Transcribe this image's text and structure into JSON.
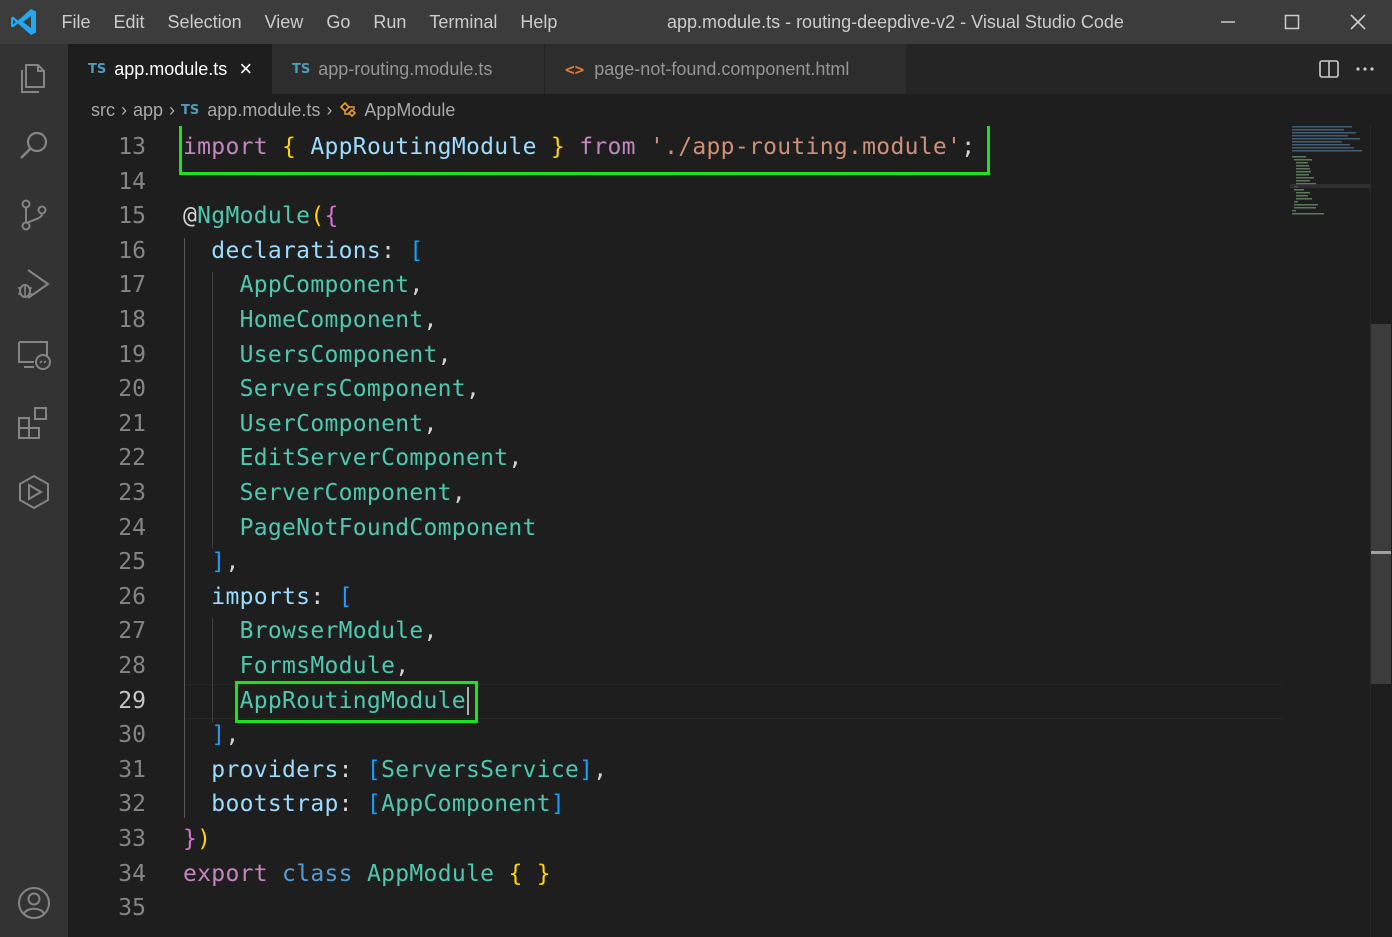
{
  "titlebar": {
    "menu": [
      "File",
      "Edit",
      "Selection",
      "View",
      "Go",
      "Run",
      "Terminal",
      "Help"
    ],
    "title": "app.module.ts - routing-deepdive-v2 - Visual Studio Code"
  },
  "activity_bar": {
    "icons": [
      "explorer-icon",
      "search-icon",
      "source-control-icon",
      "run-debug-icon",
      "remote-explorer-icon",
      "extensions-icon",
      "extra-panel-icon",
      "account-icon"
    ]
  },
  "tabs": [
    {
      "badge": "TS",
      "label": "app.module.ts",
      "active": true
    },
    {
      "badge": "TS",
      "label": "app-routing.module.ts",
      "active": false
    },
    {
      "badge": "<>",
      "label": "page-not-found.component.html",
      "active": false
    }
  ],
  "breadcrumb": {
    "parts": [
      "src",
      "app",
      "app.module.ts",
      "AppModule"
    ],
    "file_badge": "TS"
  },
  "editor": {
    "current_line": "29",
    "lines": [
      {
        "n": "13",
        "tokens": [
          [
            "kw-ctrl",
            "import"
          ],
          [
            "punc",
            " "
          ],
          [
            "brace1",
            "{"
          ],
          [
            "punc",
            " "
          ],
          [
            "prop",
            "AppRoutingModule"
          ],
          [
            "punc",
            " "
          ],
          [
            "brace1",
            "}"
          ],
          [
            "punc",
            " "
          ],
          [
            "kw-ctrl",
            "from"
          ],
          [
            "punc",
            " "
          ],
          [
            "str",
            "'./app-routing.module'"
          ],
          [
            "punc",
            ";"
          ]
        ]
      },
      {
        "n": "14",
        "tokens": []
      },
      {
        "n": "15",
        "tokens": [
          [
            "punc",
            "@"
          ],
          [
            "cls",
            "NgModule"
          ],
          [
            "brace1",
            "("
          ],
          [
            "brace2",
            "{"
          ]
        ]
      },
      {
        "n": "16",
        "tokens": [
          [
            "punc",
            "  "
          ],
          [
            "prop",
            "declarations"
          ],
          [
            "punc",
            ": "
          ],
          [
            "brace3",
            "["
          ]
        ]
      },
      {
        "n": "17",
        "tokens": [
          [
            "punc",
            "    "
          ],
          [
            "cls",
            "AppComponent"
          ],
          [
            "punc",
            ","
          ]
        ]
      },
      {
        "n": "18",
        "tokens": [
          [
            "punc",
            "    "
          ],
          [
            "cls",
            "HomeComponent"
          ],
          [
            "punc",
            ","
          ]
        ]
      },
      {
        "n": "19",
        "tokens": [
          [
            "punc",
            "    "
          ],
          [
            "cls",
            "UsersComponent"
          ],
          [
            "punc",
            ","
          ]
        ]
      },
      {
        "n": "20",
        "tokens": [
          [
            "punc",
            "    "
          ],
          [
            "cls",
            "ServersComponent"
          ],
          [
            "punc",
            ","
          ]
        ]
      },
      {
        "n": "21",
        "tokens": [
          [
            "punc",
            "    "
          ],
          [
            "cls",
            "UserComponent"
          ],
          [
            "punc",
            ","
          ]
        ]
      },
      {
        "n": "22",
        "tokens": [
          [
            "punc",
            "    "
          ],
          [
            "cls",
            "EditServerComponent"
          ],
          [
            "punc",
            ","
          ]
        ]
      },
      {
        "n": "23",
        "tokens": [
          [
            "punc",
            "    "
          ],
          [
            "cls",
            "ServerComponent"
          ],
          [
            "punc",
            ","
          ]
        ]
      },
      {
        "n": "24",
        "tokens": [
          [
            "punc",
            "    "
          ],
          [
            "cls",
            "PageNotFoundComponent"
          ]
        ]
      },
      {
        "n": "25",
        "tokens": [
          [
            "punc",
            "  "
          ],
          [
            "brace3",
            "]"
          ],
          [
            "punc",
            ","
          ]
        ]
      },
      {
        "n": "26",
        "tokens": [
          [
            "punc",
            "  "
          ],
          [
            "prop",
            "imports"
          ],
          [
            "punc",
            ": "
          ],
          [
            "brace3",
            "["
          ]
        ]
      },
      {
        "n": "27",
        "tokens": [
          [
            "punc",
            "    "
          ],
          [
            "cls",
            "BrowserModule"
          ],
          [
            "punc",
            ","
          ]
        ]
      },
      {
        "n": "28",
        "tokens": [
          [
            "punc",
            "    "
          ],
          [
            "cls",
            "FormsModule"
          ],
          [
            "punc",
            ","
          ]
        ]
      },
      {
        "n": "29",
        "tokens": [
          [
            "punc",
            "    "
          ],
          [
            "cls",
            "AppRoutingModule"
          ]
        ]
      },
      {
        "n": "30",
        "tokens": [
          [
            "punc",
            "  "
          ],
          [
            "brace3",
            "]"
          ],
          [
            "punc",
            ","
          ]
        ]
      },
      {
        "n": "31",
        "tokens": [
          [
            "punc",
            "  "
          ],
          [
            "prop",
            "providers"
          ],
          [
            "punc",
            ": "
          ],
          [
            "brace3",
            "["
          ],
          [
            "cls",
            "ServersService"
          ],
          [
            "brace3",
            "]"
          ],
          [
            "punc",
            ","
          ]
        ]
      },
      {
        "n": "32",
        "tokens": [
          [
            "punc",
            "  "
          ],
          [
            "prop",
            "bootstrap"
          ],
          [
            "punc",
            ": "
          ],
          [
            "brace3",
            "["
          ],
          [
            "cls",
            "AppComponent"
          ],
          [
            "brace3",
            "]"
          ]
        ]
      },
      {
        "n": "33",
        "tokens": [
          [
            "brace2",
            "}"
          ],
          [
            "brace1",
            ")"
          ]
        ]
      },
      {
        "n": "34",
        "tokens": [
          [
            "kw-ctrl",
            "export"
          ],
          [
            "punc",
            " "
          ],
          [
            "kw",
            "class"
          ],
          [
            "punc",
            " "
          ],
          [
            "cls",
            "AppModule"
          ],
          [
            "punc",
            " "
          ],
          [
            "brace1",
            "{"
          ],
          [
            "punc",
            " "
          ],
          [
            "brace1",
            "}"
          ]
        ]
      },
      {
        "n": "35",
        "tokens": []
      }
    ]
  },
  "colors": {
    "highlight_box": "#19e619",
    "accent": "#007acc"
  }
}
